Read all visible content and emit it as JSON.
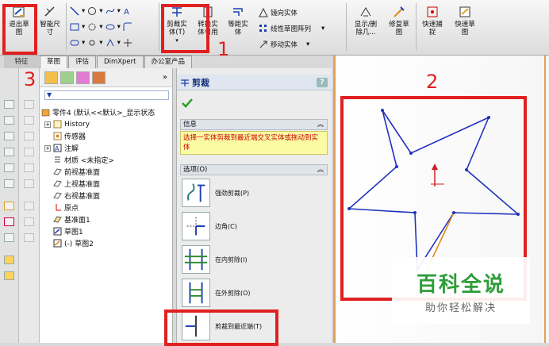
{
  "toolbar": {
    "exit_sketch": "退出草\n图",
    "smart_dimension": "智能尺\n寸",
    "trim_entities": "剪裁实\n体(T)",
    "convert_entities": "转换实\n体引用",
    "offset_entities": "等距实\n体",
    "mirror_entities": "镜向实体",
    "linear_pattern": "线性草图阵列",
    "move_entities": "移动实体",
    "display_delete": "显示/删\n除几...",
    "repair_sketch": "修复草\n图",
    "quick_snaps": "快速捕\n捉",
    "rapid_sketch": "快速草\n图"
  },
  "tabs": {
    "feature": "特征",
    "sketch": "草图",
    "evaluate": "评估",
    "dimxpert": "DimXpert",
    "office": "办公室产品"
  },
  "tree": {
    "root": "零件4 (默认<<默认>_显示状态",
    "items": [
      "History",
      "传感器",
      "注解",
      "材质 <未指定>",
      "前视基准面",
      "上视基准面",
      "右视基准面",
      "原点",
      "基准面1",
      "草图1",
      "(-) 草图2"
    ]
  },
  "property_manager": {
    "title": "剪裁",
    "help": "?",
    "info_header": "信息",
    "info_text": "选择一实体剪裁到最近端交叉实体或拖动到实体",
    "options_header": "选项(O)",
    "options": [
      "强劲剪裁(P)",
      "边角(C)",
      "在内剪除(I)",
      "在外剪除(O)",
      "剪裁到最近端(T)"
    ]
  },
  "annotations": [
    "1",
    "2",
    "3"
  ],
  "watermark": {
    "title": "百科全说",
    "subtitle": "助你轻松解决"
  },
  "colors": {
    "accent_red": "#e02020",
    "sketch_blue": "#2233bb",
    "sketch_orange": "#e08a20",
    "watermark_green": "#2e9d3a"
  }
}
